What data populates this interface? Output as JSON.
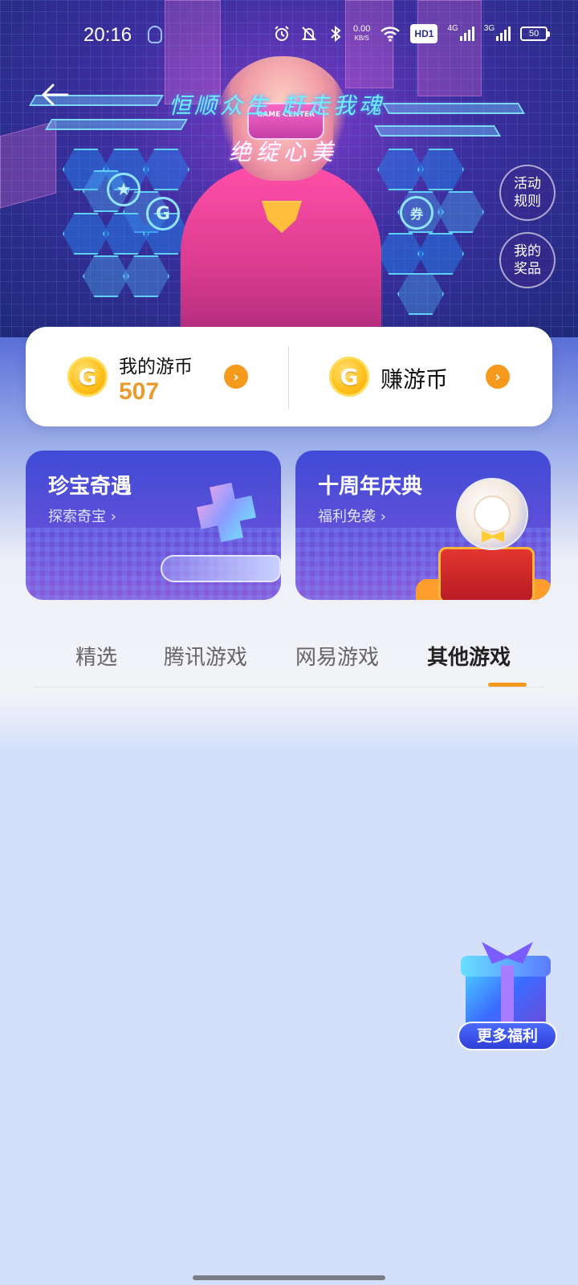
{
  "status_bar": {
    "time": "20:16",
    "net_speed_value": "0.00",
    "net_speed_unit": "KB/S",
    "hd_label": "HD1",
    "signal_1_label": "4G",
    "signal_2_label": "3G",
    "battery": "50"
  },
  "hero": {
    "slogan_line1": "恒顺众生 赶走我魂",
    "slogan_line2": "绝绽心美",
    "headset_text": "GAME CENTER"
  },
  "side_buttons": {
    "rules_line1": "活动",
    "rules_line2": "规则",
    "prizes_line1": "我的",
    "prizes_line2": "奖品"
  },
  "coin_card": {
    "coin_glyph": "G",
    "my_coins_label": "我的游币",
    "my_coins_value": "507",
    "earn_label": "赚游币",
    "arrow_glyph": "›"
  },
  "promos": [
    {
      "title": "珍宝奇遇",
      "subtitle": "探索奇宝 ›"
    },
    {
      "title": "十周年庆典",
      "subtitle": "福利免袭 ›"
    }
  ],
  "tabs": [
    {
      "label": "精选",
      "active": false
    },
    {
      "label": "腾讯游戏",
      "active": false
    },
    {
      "label": "网易游戏",
      "active": false
    },
    {
      "label": "其他游戏",
      "active": true
    }
  ],
  "floating_gift": {
    "label": "更多福利"
  },
  "colors": {
    "accent_orange": "#f59a1c",
    "coin_value": "#e99b2e",
    "page_background": "#d4e0fa"
  },
  "icons": [
    "back-arrow-icon",
    "qq-icon",
    "alarm-icon",
    "mute-icon",
    "bluetooth-icon",
    "wifi-icon",
    "signal-icon",
    "battery-icon",
    "coin-icon",
    "chevron-right-icon",
    "gift-icon"
  ]
}
